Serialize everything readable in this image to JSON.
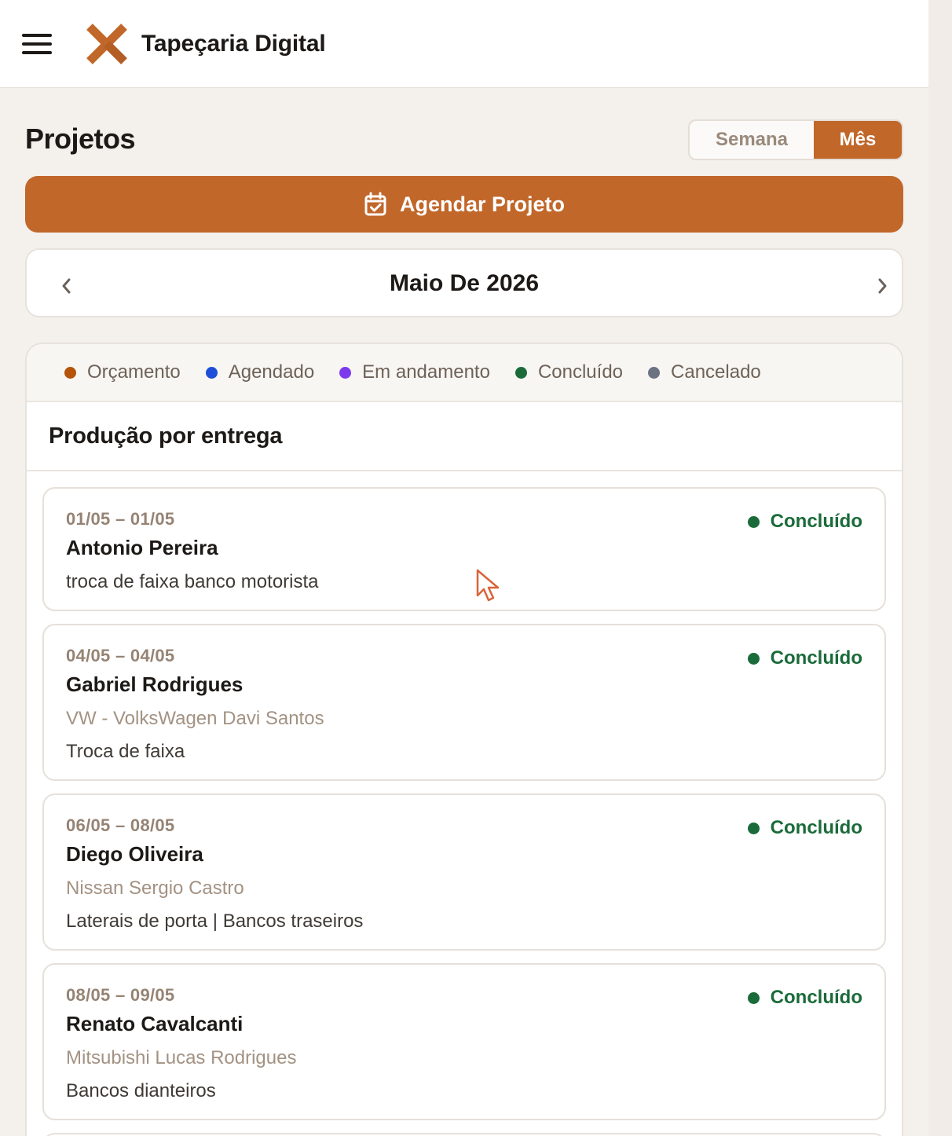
{
  "header": {
    "brand": "Tapeçaria Digital"
  },
  "page": {
    "title": "Projetos"
  },
  "view_toggle": {
    "week": "Semana",
    "month": "Mês",
    "selected": "Mês"
  },
  "schedule_button": {
    "label": "Agendar Projeto"
  },
  "month_nav": {
    "title": "Maio De 2026"
  },
  "legend": [
    {
      "label": "Orçamento",
      "color": "#b45309"
    },
    {
      "label": "Agendado",
      "color": "#1d4ed8"
    },
    {
      "label": "Em andamento",
      "color": "#7c3aed"
    },
    {
      "label": "Concluído",
      "color": "#1b6b3a"
    },
    {
      "label": "Cancelado",
      "color": "#6b7280"
    }
  ],
  "section": {
    "title": "Produção por entrega"
  },
  "projects": [
    {
      "dates": "01/05 – 01/05",
      "client": "Antonio Pereira",
      "vehicle": "",
      "service": "troca de faixa banco motorista",
      "status": "Concluído"
    },
    {
      "dates": "04/05 – 04/05",
      "client": "Gabriel Rodrigues",
      "vehicle": "VW - VolksWagen Davi Santos",
      "service": "Troca de faixa",
      "status": "Concluído"
    },
    {
      "dates": "06/05 – 08/05",
      "client": "Diego Oliveira",
      "vehicle": "Nissan Sergio Castro",
      "service": "Laterais de porta | Bancos traseiros",
      "status": "Concluído"
    },
    {
      "dates": "08/05 – 09/05",
      "client": "Renato Cavalcanti",
      "vehicle": "Mitsubishi Lucas Rodrigues",
      "service": "Bancos dianteiros",
      "status": "Concluído"
    }
  ],
  "colors": {
    "accent": "#c1672a",
    "success": "#1b6b3a"
  }
}
